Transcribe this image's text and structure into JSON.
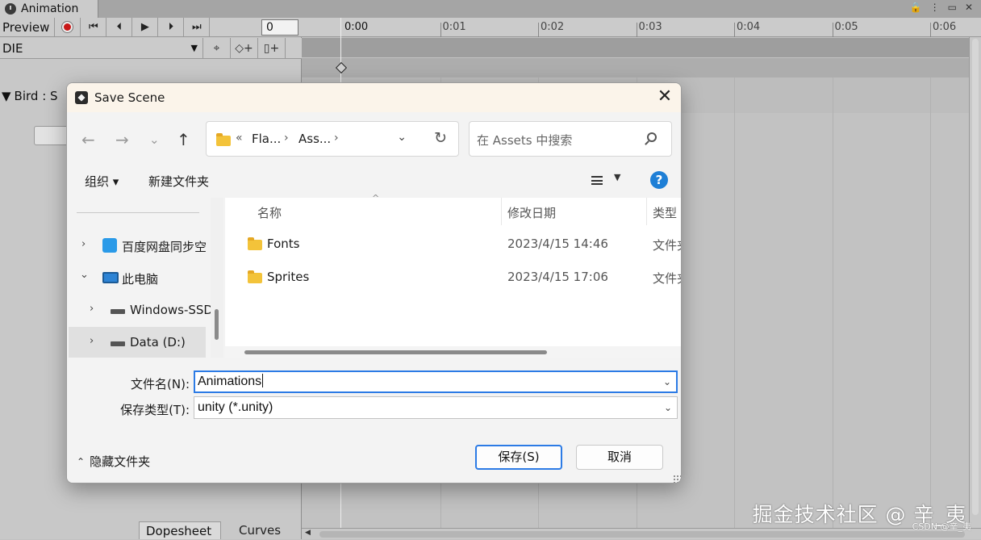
{
  "unity": {
    "tab_title": "Animation",
    "preview_label": "Preview",
    "frame_value": "0",
    "clip_name": "DIE",
    "property_label": "Bird : S",
    "timeline_ticks": [
      "0:00",
      "0:01",
      "0:02",
      "0:03",
      "0:04",
      "0:05",
      "0:06"
    ],
    "bottom_tabs": {
      "dopesheet": "Dopesheet",
      "curves": "Curves"
    }
  },
  "dialog": {
    "title": "Save Scene",
    "breadcrumb": {
      "overflow": "«",
      "part1": "Fla...",
      "part2": "Ass...",
      "sep": "›"
    },
    "search_placeholder": "在 Assets 中搜索",
    "toolbar": {
      "organize": "组织 ▾",
      "new_folder": "新建文件夹"
    },
    "nav_items": [
      {
        "label": "百度网盘同步空",
        "chevron": "›",
        "icon": "baidu-netdisk-icon"
      },
      {
        "label": "此电脑",
        "chevron": "⌄",
        "icon": "computer-icon"
      },
      {
        "label": "Windows-SSD",
        "chevron": "›",
        "icon": "drive-icon"
      },
      {
        "label": "Data (D:)",
        "chevron": "›",
        "icon": "drive-icon"
      }
    ],
    "columns": {
      "name": "名称",
      "date": "修改日期",
      "type": "类型"
    },
    "files": [
      {
        "name": "Fonts",
        "date": "2023/4/15 14:46",
        "type": "文件夹"
      },
      {
        "name": "Sprites",
        "date": "2023/4/15 17:06",
        "type": "文件夹"
      }
    ],
    "filename_label": "文件名(N):",
    "filename_value": "Animations",
    "filetype_label": "保存类型(T):",
    "filetype_value": "unity (*.unity)",
    "hide_folders": "隐藏文件夹",
    "save_button": "保存(S)",
    "cancel_button": "取消"
  },
  "watermark": {
    "main": "掘金技术社区 @ 辛_夷",
    "sub": "CSDN @辛_夷"
  },
  "colors": {
    "accent": "#2c7be5",
    "folder": "#f3c33a",
    "record": "#c81818"
  }
}
